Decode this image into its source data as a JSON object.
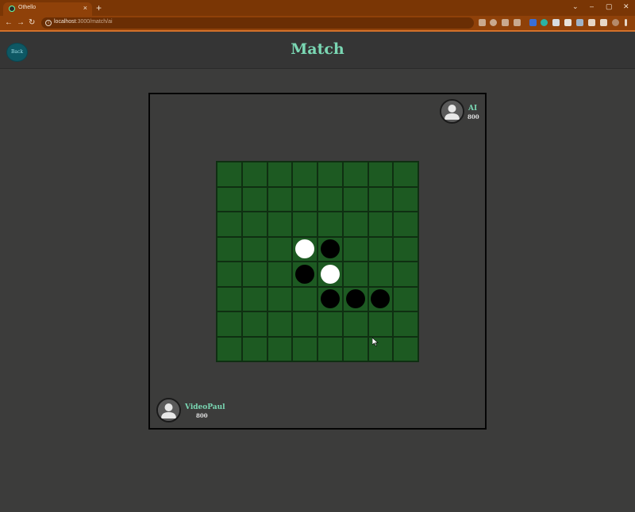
{
  "browser": {
    "tab_title": "Othello",
    "tab_close": "×",
    "new_tab": "+",
    "url_host": "localhost",
    "url_path": ":3000/match/ai",
    "nav": {
      "back": "←",
      "forward": "→",
      "reload": "↻"
    },
    "window_controls": {
      "chevron": "⌄",
      "minimize": "–",
      "maximize": "▢",
      "close": "✕"
    }
  },
  "header": {
    "back_label": "Back",
    "title": "Match"
  },
  "players": {
    "top": {
      "name": "AI",
      "rating": "800",
      "icon": "user-avatar-icon"
    },
    "bottom": {
      "name": "VideoPaul",
      "rating": "800",
      "icon": "user-avatar-icon"
    }
  },
  "board": {
    "size": 8,
    "cells": [
      [
        "",
        "",
        "",
        "",
        "",
        "",
        "",
        ""
      ],
      [
        "",
        "",
        "",
        "",
        "",
        "",
        "",
        ""
      ],
      [
        "",
        "",
        "",
        "",
        "",
        "",
        "",
        ""
      ],
      [
        "",
        "",
        "",
        "W",
        "B",
        "",
        "",
        ""
      ],
      [
        "",
        "",
        "",
        "B",
        "W",
        "",
        "",
        ""
      ],
      [
        "",
        "",
        "",
        "",
        "B",
        "B",
        "B",
        ""
      ],
      [
        "",
        "",
        "",
        "",
        "",
        "",
        "",
        ""
      ],
      [
        "",
        "",
        "",
        "",
        "",
        "",
        "",
        ""
      ]
    ]
  },
  "colors": {
    "board_green": "#1d5a22",
    "accent_text": "#7ad7b3",
    "page_bg": "#3c3c3b",
    "browser_orange": "#7a3605"
  }
}
